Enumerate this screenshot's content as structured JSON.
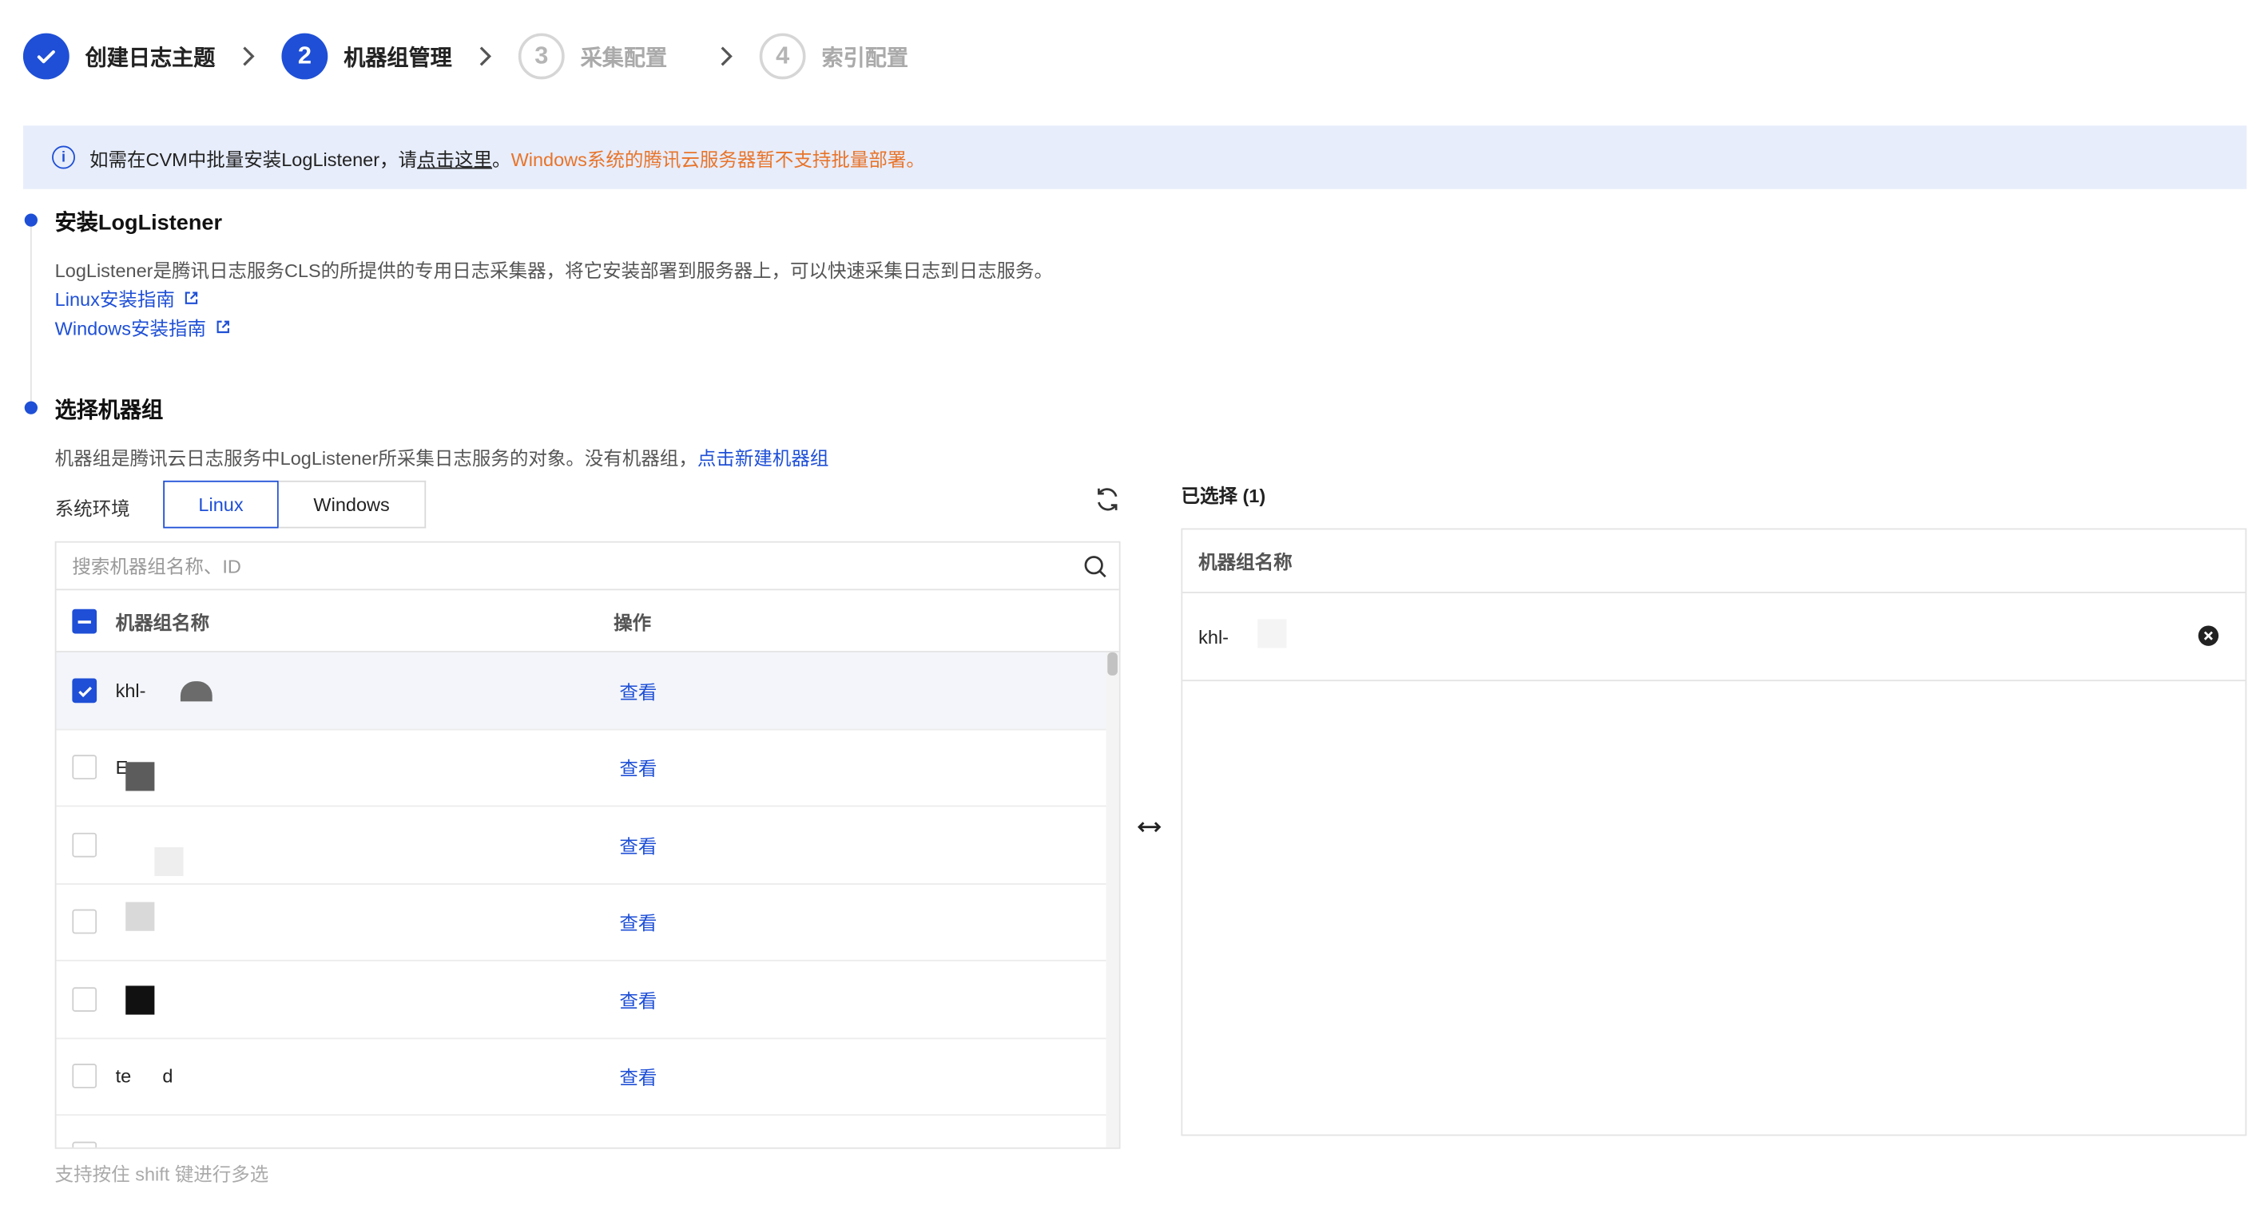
{
  "steps": [
    {
      "number": "",
      "label": "创建日志主题",
      "state": "done"
    },
    {
      "number": "2",
      "label": "机器组管理",
      "state": "active"
    },
    {
      "number": "3",
      "label": "采集配置",
      "state": "todo"
    },
    {
      "number": "4",
      "label": "索引配置",
      "state": "todo"
    }
  ],
  "banner": {
    "text_before": "如需在CVM中批量安装LogListener，请",
    "link_text": "点击这里",
    "text_after": "。",
    "warning": "Windows系统的腾讯云服务器暂不支持批量部署。"
  },
  "install": {
    "title": "安装LogListener",
    "description": "LogListener是腾讯日志服务CLS的所提供的专用日志采集器，将它安装部署到服务器上，可以快速采集日志到日志服务。",
    "linux_guide": "Linux安装指南",
    "windows_guide": "Windows安装指南"
  },
  "select_group": {
    "title": "选择机器组",
    "description": "机器组是腾讯云日志服务中LogListener所采集日志服务的对象。没有机器组，",
    "create_link": "点击新建机器组"
  },
  "env": {
    "label": "系统环境",
    "options": [
      "Linux",
      "Windows"
    ],
    "selected": "Linux"
  },
  "table": {
    "search_placeholder": "搜索机器组名称、ID",
    "col_name": "机器组名称",
    "col_op": "操作",
    "rows": [
      {
        "name": "khl-",
        "action": "查看",
        "checked": true,
        "blur_color": "#6b6b6b"
      },
      {
        "name": "E",
        "action": "查看",
        "checked": false,
        "blur_color": "#5c5c5c"
      },
      {
        "name": "",
        "action": "查看",
        "checked": false,
        "blur_color": "#eeeeee"
      },
      {
        "name": "",
        "action": "查看",
        "checked": false,
        "blur_color": "#d9d9d9"
      },
      {
        "name": "",
        "action": "查看",
        "checked": false,
        "blur_color": "#111111"
      },
      {
        "name": "te      d",
        "action": "查看",
        "checked": false,
        "blur_color": ""
      }
    ]
  },
  "hint": "支持按住 shift 键进行多选",
  "selected_panel": {
    "title": "已选择 (1)",
    "col_name": "机器组名称",
    "items": [
      {
        "name": "khl-"
      }
    ]
  },
  "colors": {
    "primary": "#1e4fd6",
    "warning": "#e8742a",
    "banner_bg": "#e7edfb"
  }
}
